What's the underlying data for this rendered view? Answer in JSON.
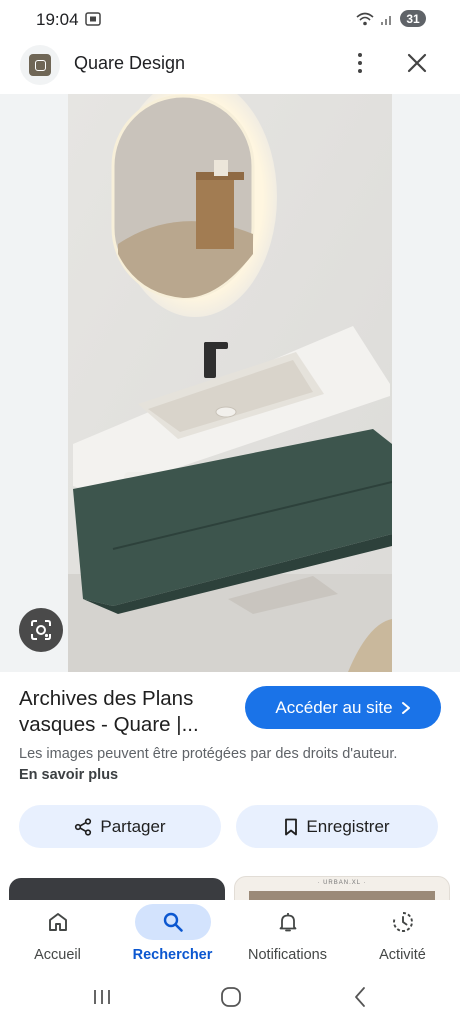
{
  "status_bar": {
    "time": "19:04",
    "battery": "31"
  },
  "header": {
    "site_name": "Quare Design"
  },
  "result": {
    "title": "Archives des Plans vasques - Quare |...",
    "visit_button": "Accéder au site",
    "copyright_text": "Les images peuvent être protégées par des droits d'auteur.",
    "learn_more": "En savoir plus"
  },
  "actions": {
    "share": "Partager",
    "save": "Enregistrer"
  },
  "related": {
    "right_thumb_label": "· URBAN.XL ·"
  },
  "bottom_nav": {
    "items": [
      {
        "label": "Accueil",
        "icon": "home-icon",
        "active": false
      },
      {
        "label": "Rechercher",
        "icon": "search-icon",
        "active": true
      },
      {
        "label": "Notifications",
        "icon": "bell-icon",
        "active": false
      },
      {
        "label": "Activité",
        "icon": "activity-icon",
        "active": false
      }
    ]
  },
  "colors": {
    "accent": "#1a73e8",
    "active_nav": "#0b57d0",
    "tonal_button": "#e8f0fe",
    "active_pill": "#d3e3fd"
  }
}
